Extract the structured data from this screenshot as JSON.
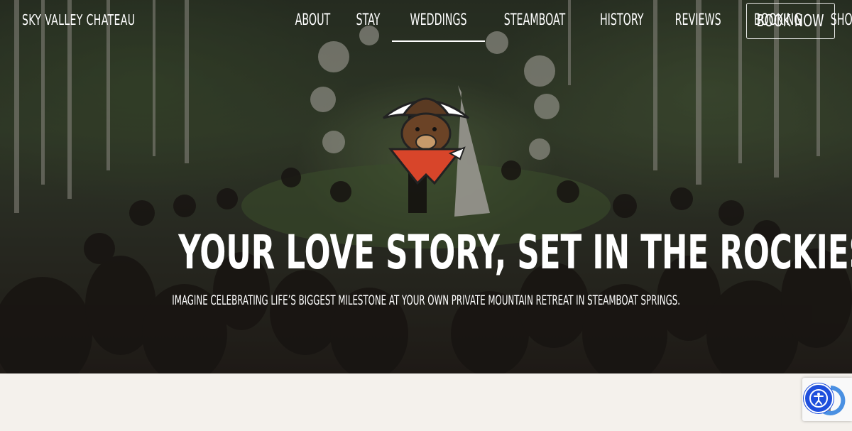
{
  "header": {
    "logo_text": "SKY VALLEY CHATEAU",
    "nav": [
      {
        "label": "ABOUT",
        "active": false
      },
      {
        "label": "STAY",
        "active": false
      },
      {
        "label": "WEDDINGS",
        "active": true
      },
      {
        "label": "STEAMBOAT",
        "active": false
      },
      {
        "label": "HISTORY",
        "active": false
      },
      {
        "label": "REVIEWS",
        "active": false
      },
      {
        "label": "BOOKING",
        "active": false
      },
      {
        "label": "SHOP",
        "active": false
      }
    ],
    "cta_label": "BOOK NOW"
  },
  "hero": {
    "title": "YOUR LOVE STORY, SET IN THE ROCKIES",
    "subtitle": "IMAGINE CELEBRATING LIFE’S BIGGEST MILESTONE AT YOUR OWN PRIVATE MOUNTAIN RETREAT IN STEAMBOAT SPRINGS.",
    "mascot_icon": "cowboy-bear-icon"
  },
  "widgets": {
    "accessibility_icon": "accessibility-icon",
    "recaptcha_icon": "recaptcha-icon"
  },
  "colors": {
    "hero_text": "#ffffff",
    "page_background": "#f4f1ec",
    "accessibility_blue": "#1f4fdc",
    "mascot_red": "#d8452a"
  }
}
